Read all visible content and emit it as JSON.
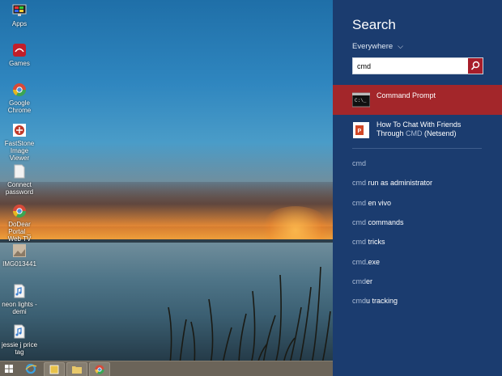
{
  "desktop_icons": [
    {
      "id": "apps",
      "label": "Apps",
      "icon": "monitor-icon",
      "color": "#3a6fc2"
    },
    {
      "id": "games",
      "label": "Games",
      "icon": "game-controller-icon",
      "color": "#c21e2a"
    },
    {
      "id": "google-chrome",
      "label": "Google Chrome",
      "icon": "chrome-icon",
      "color": "#e6b71e"
    },
    {
      "id": "faststone",
      "label": "FastStone Image Viewer",
      "icon": "faststone-icon",
      "color": "#c03a2b"
    },
    {
      "id": "connect-password",
      "label": "Connect password",
      "icon": "document-icon",
      "color": "#f2f2f2"
    },
    {
      "id": "dodear",
      "label": "DoDear Portal _ Web TV",
      "icon": "chrome-icon",
      "color": "#e6b71e"
    },
    {
      "id": "img",
      "label": "IMG013441",
      "icon": "image-icon",
      "color": "#c9b9a3"
    },
    {
      "id": "neon",
      "label": "neon lights - demi",
      "icon": "music-file-icon",
      "color": "#f4f4f4"
    },
    {
      "id": "jessie",
      "label": "jessie j price tag",
      "icon": "music-file-icon",
      "color": "#f4f4f4"
    }
  ],
  "taskbar": {
    "buttons": [
      "start-button",
      "ie-button",
      "media-player-button",
      "file-explorer-button",
      "chrome-button"
    ]
  },
  "search_panel": {
    "title": "Search",
    "scope": "Everywhere",
    "query": "cmd",
    "results": [
      {
        "line1": "Command Prompt",
        "line2": "",
        "icon": "command-prompt-icon",
        "selected": true
      },
      {
        "line1": "How To Chat With Friends",
        "line2_pre": "Through ",
        "line2_hl": "CMD",
        "line2_post": " (Netsend)",
        "icon": "office-document-icon",
        "selected": false
      }
    ],
    "suggestions": [
      {
        "q": "cmd",
        "rest": ""
      },
      {
        "q": "cmd",
        "rest": " run as administrator"
      },
      {
        "q": "cmd",
        "rest": " en vivo"
      },
      {
        "q": "cmd",
        "rest": " commands"
      },
      {
        "q": "cmd",
        "rest": " tricks"
      },
      {
        "q": "cmd",
        "rest": ".exe"
      },
      {
        "q": "cmd",
        "rest": "er"
      },
      {
        "q": "cmd",
        "rest": "u tracking"
      }
    ]
  },
  "colors": {
    "panel_bg": "#1b3c6f",
    "selected_bg": "#a3262a",
    "search_button": "#a71d2a"
  }
}
